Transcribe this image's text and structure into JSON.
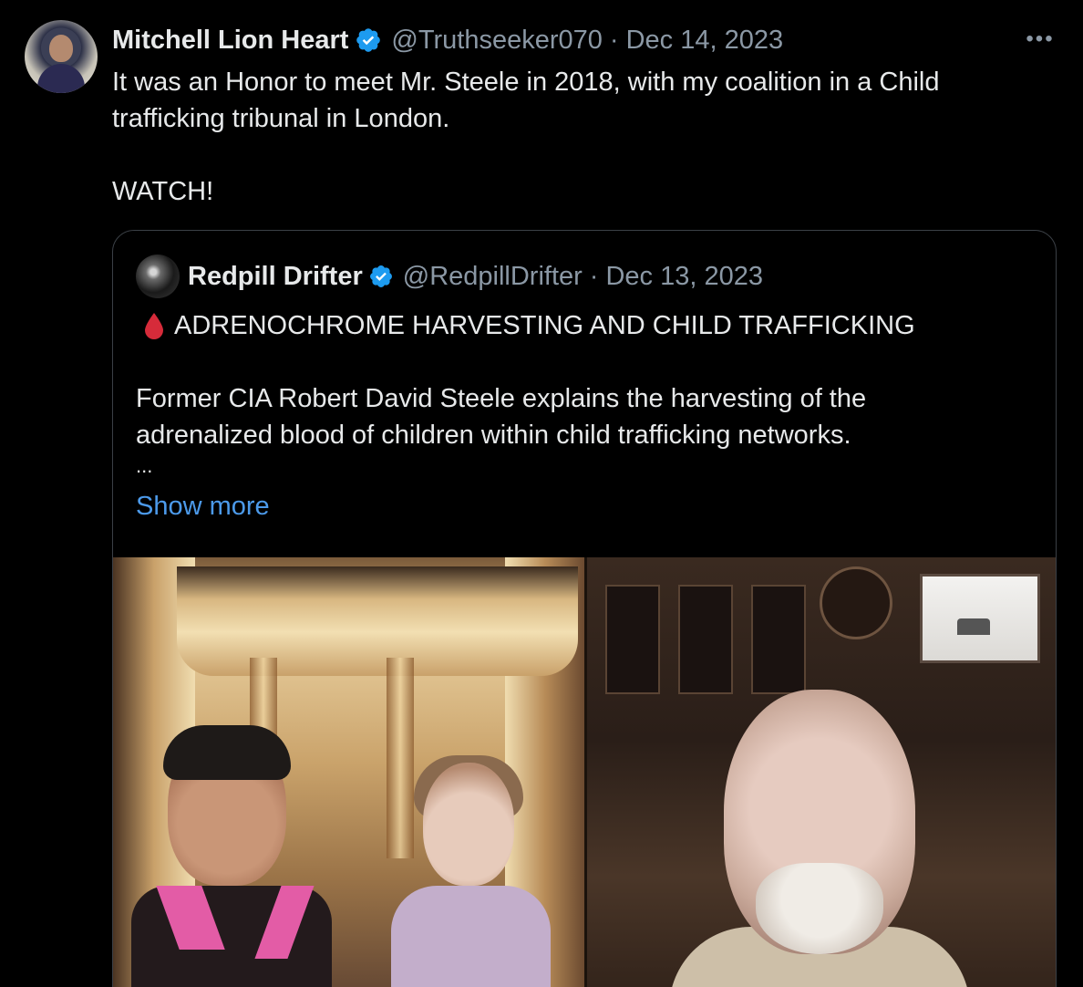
{
  "tweet": {
    "author": {
      "name": "Mitchell Lion Heart",
      "handle": "@Truthseeker070",
      "separator": "·",
      "date": "Dec 14, 2023",
      "verified": true,
      "avatar_icon": "user-avatar"
    },
    "more_label": "•••",
    "text_line1": "It was an Honor to meet Mr. Steele in 2018, with my coalition in a Child trafficking tribunal in London.",
    "text_line2": "WATCH!",
    "quoted": {
      "author": {
        "name": "Redpill Drifter",
        "handle": "@RedpillDrifter",
        "separator": "·",
        "date": "Dec 13, 2023",
        "verified": true,
        "avatar_icon": "user-avatar"
      },
      "title_icon": "blood-drop-icon",
      "title": "ADRENOCHROME HARVESTING AND CHILD TRAFFICKING",
      "body": "Former CIA Robert David Steele explains the harvesting of the adrenalized blood of children within child trafficking networks.",
      "ellipsis": "...",
      "show_more": "Show more"
    }
  },
  "colors": {
    "background": "#000000",
    "text": "#e7e9ea",
    "muted": "#8b98a5",
    "link": "#4c9aea",
    "verified": "#1d9bf0",
    "border": "#3b4046",
    "blood_drop": "#d62b3a"
  }
}
